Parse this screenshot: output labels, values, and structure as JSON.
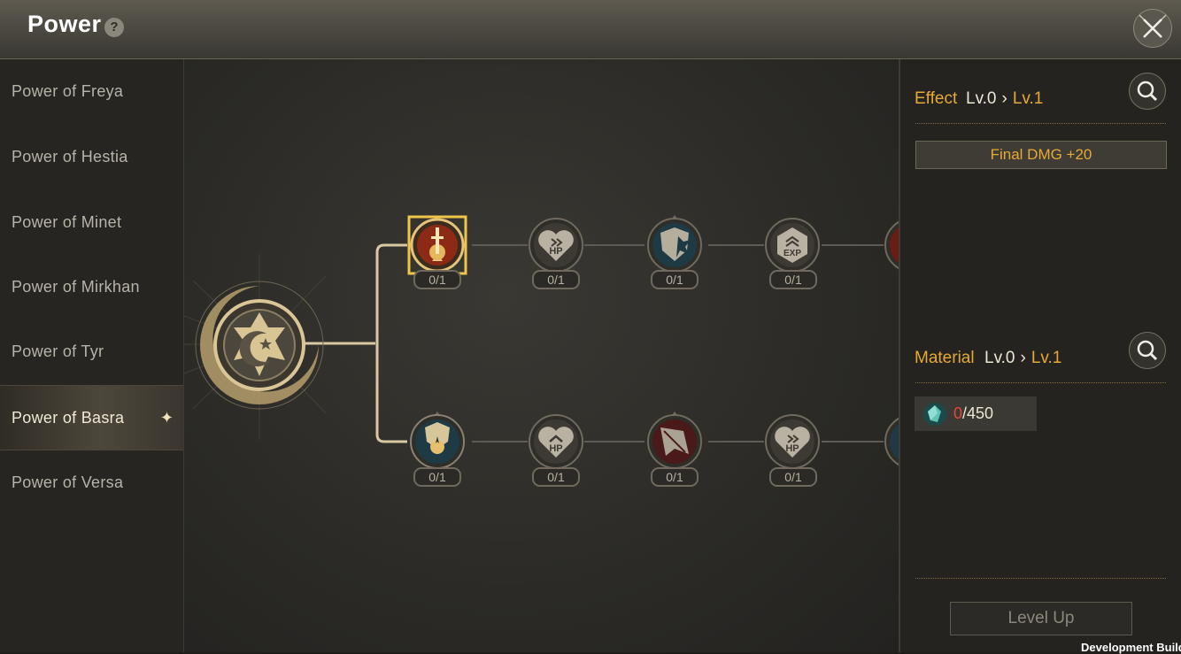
{
  "header": {
    "title": "Power",
    "help_icon": "?"
  },
  "sidebar": {
    "items": [
      {
        "label": "Power of Freya"
      },
      {
        "label": "Power of Hestia"
      },
      {
        "label": "Power of Minet"
      },
      {
        "label": "Power of Mirkhan"
      },
      {
        "label": "Power of Tyr"
      },
      {
        "label": "Power of Basra",
        "active": true
      },
      {
        "label": "Power of Versa"
      }
    ]
  },
  "tree": {
    "top_row": [
      {
        "icon": "sword-sun-icon",
        "progress": "0/1",
        "selected": true
      },
      {
        "icon": "hp-heart-icon",
        "progress": "0/1"
      },
      {
        "icon": "shield-burst-icon",
        "progress": "0/1"
      },
      {
        "icon": "exp-shield-icon",
        "progress": "0/1"
      },
      {
        "icon": "partial-node-icon",
        "progress": ""
      }
    ],
    "bottom_row": [
      {
        "icon": "shield-sun-icon",
        "progress": "0/1"
      },
      {
        "icon": "hp-up-heart-icon",
        "progress": "0/1"
      },
      {
        "icon": "leaf-spike-icon",
        "progress": "0/1"
      },
      {
        "icon": "hp-heart-icon",
        "progress": "0/1"
      },
      {
        "icon": "partial-node-icon",
        "progress": ""
      }
    ],
    "root_icon": "crescent-star-icon"
  },
  "effect": {
    "title": "Effect",
    "from_level": "Lv.0",
    "to_level": "Lv.1",
    "value": "Final DMG +20"
  },
  "material": {
    "title": "Material",
    "from_level": "Lv.0",
    "to_level": "Lv.1",
    "have": "0",
    "need": "/450",
    "item_icon": "teal-crystal-icon"
  },
  "actions": {
    "level_up": "Level Up"
  },
  "footer": {
    "build_label": "Development Build"
  },
  "colors": {
    "accent": "#e7a935",
    "insufficient": "#e04a36"
  }
}
